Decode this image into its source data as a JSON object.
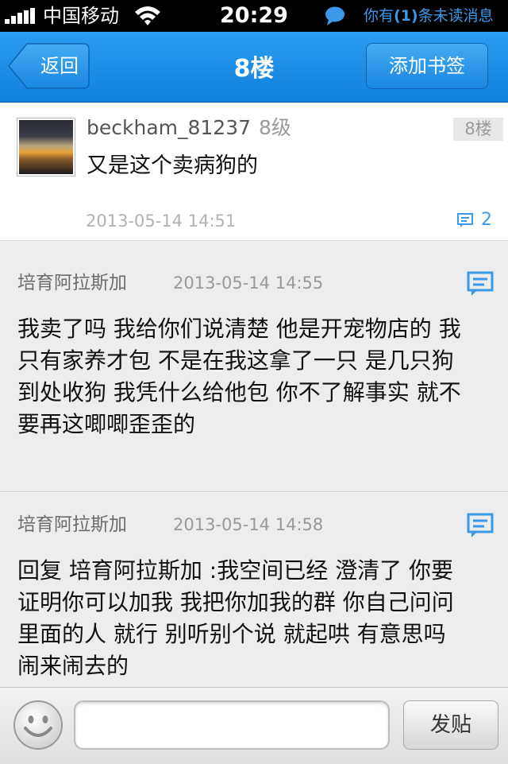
{
  "status_bar": {
    "carrier": "中国移动",
    "time": "20:29",
    "unread_prefix": "你有",
    "unread_count": "(1)",
    "unread_suffix": "条未读消息"
  },
  "nav": {
    "back_label": "返回",
    "title": "8楼",
    "bookmark_label": "添加书签"
  },
  "main_post": {
    "username": "beckham_81237",
    "level": "8级",
    "floor": "8楼",
    "content": "又是这个卖病狗的",
    "timestamp": "2013-05-14 14:51",
    "reply_count": "2"
  },
  "replies": [
    {
      "author": "培育阿拉斯加",
      "timestamp": "2013-05-14 14:55",
      "content": "我卖了吗 我给你们说清楚 他是开宠物店的 我只有家养才包 不是在我这拿了一只 是几只狗 到处收狗 我凭什么给他包 你不了解事实 就不要再这唧唧歪歪的"
    },
    {
      "author": "培育阿拉斯加",
      "timestamp": "2013-05-14 14:58",
      "content": "回复 培育阿拉斯加 :我空间已经 澄清了 你要证明你可以加我 我把你加我的群 你自己问问里面的人 就行 别听别个说 就起哄 有意思吗 闹来闹去的"
    }
  ],
  "bottom_bar": {
    "input_value": "",
    "post_label": "发贴"
  },
  "colors": {
    "accent": "#1a8ae6",
    "link": "#3a99e8"
  },
  "icons": [
    "signal-icon",
    "wifi-icon",
    "chat-bubble-icon",
    "back-arrow-icon",
    "comment-icon",
    "emoji-icon"
  ]
}
